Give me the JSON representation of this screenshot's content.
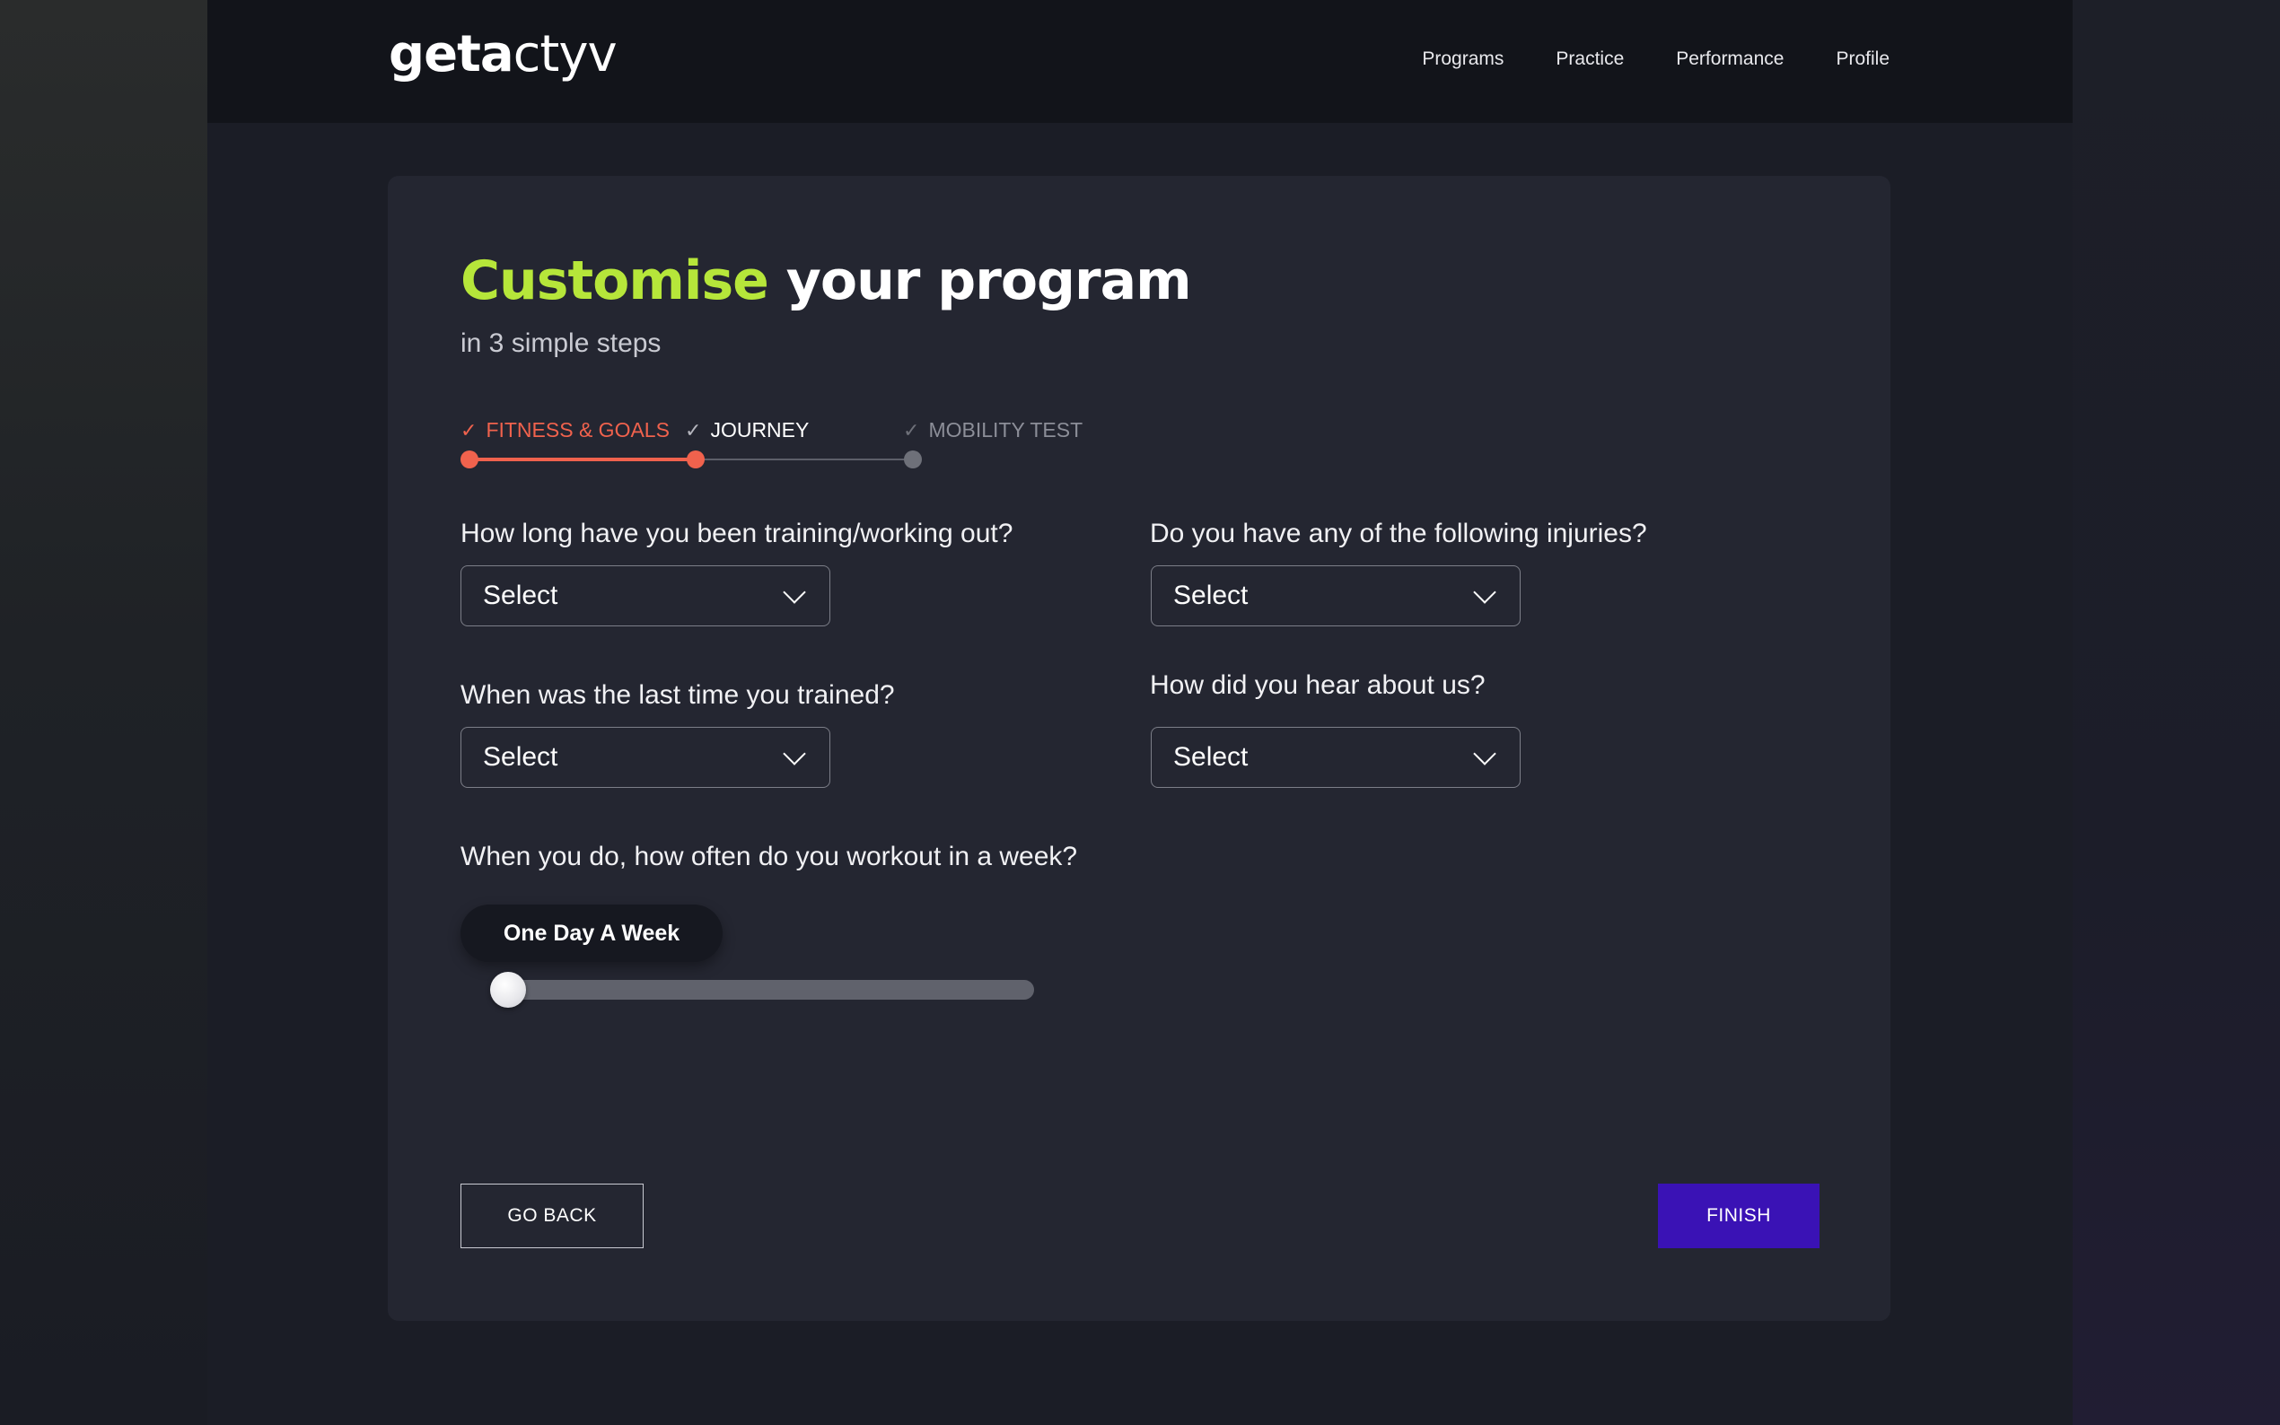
{
  "header": {
    "logo": {
      "bold": "geta",
      "thin": "ctyv"
    },
    "nav": [
      "Programs",
      "Practice",
      "Performance",
      "Profile"
    ]
  },
  "main": {
    "title": {
      "highlight": "Customise",
      "rest": "your program"
    },
    "subtitle": "in 3 simple steps",
    "steps": [
      {
        "label": "FITNESS & GOALS",
        "state": "complete"
      },
      {
        "label": "JOURNEY",
        "state": "current"
      },
      {
        "label": "MOBILITY TEST",
        "state": "upcoming"
      }
    ],
    "questions": {
      "training_duration": {
        "label": "How long have you been training/working out?",
        "value": "Select"
      },
      "injuries": {
        "label": "Do you have any of the following injuries?",
        "value": "Select"
      },
      "last_trained": {
        "label": "When was the last time you trained?",
        "value": "Select"
      },
      "heard_about": {
        "label": "How did you hear about us?",
        "value": "Select"
      },
      "frequency": {
        "label": "When you do, how often do you workout in a week?",
        "value": "One Day A Week",
        "slider_fraction": 0.0
      }
    },
    "buttons": {
      "back": "GO BACK",
      "finish": "FINISH"
    }
  },
  "colors": {
    "accent_green": "#b6e63a",
    "step_active": "#f0624d",
    "finish_button": "#3a12b5",
    "card_bg": "#242631"
  }
}
